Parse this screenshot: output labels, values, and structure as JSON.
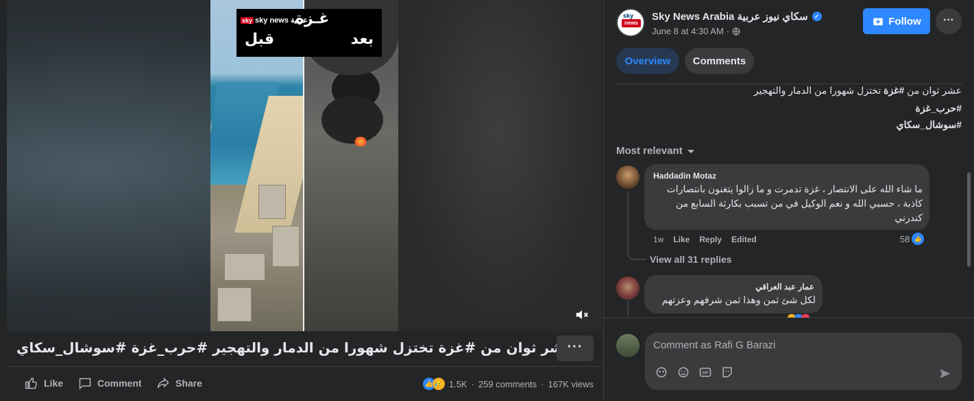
{
  "video": {
    "overlay_logo": "sky news عربية",
    "overlay_title": "غـزة",
    "overlay_before": "قبل",
    "overlay_after": "بعد",
    "title": "عشر ثوان من #غزة تختزل شهورا من الدمار والتهجير #حرب_غزة #سوشال_سكاي"
  },
  "actions": {
    "like": "Like",
    "comment": "Comment",
    "share": "Share",
    "reactions_count": "1.5K",
    "comments_count": "259 comments",
    "views": "167K views"
  },
  "post": {
    "page_name": "Sky News Arabia سكاي نيوز عربية",
    "date": "June 8 at 4:30 AM",
    "follow_label": "Follow",
    "tabs": [
      "Overview",
      "Comments"
    ],
    "caption_line1_pre": "عشر ثوان من ",
    "caption_line1_tag": "#غزة",
    "caption_line1_post": " تختزل شهورا من الدمار والتهجير",
    "caption_tag2": "#حرب_غزة",
    "caption_tag3": "#سوشال_سكاي"
  },
  "comments": {
    "sort_label": "Most relevant",
    "items": [
      {
        "author": "Haddadin Motaz",
        "text": "ما شاء الله على الانتصار ، غزة تدمرت و ما زالوا يتغنون بانتصارات كاذبة ، حسبي الله و نعم الوكيل في من تسبب بكارثة السابع من كندرني",
        "time": "1w",
        "like": "Like",
        "reply": "Reply",
        "edited": "Edited",
        "likes": "58",
        "view_replies": "View all 31 replies"
      },
      {
        "author": "عمار عبد العراقي",
        "text": "لكل شئ ثمن وهذا ثمن شرفهم وعزتهم"
      }
    ],
    "input_placeholder": "Comment as Rafi G Barazi"
  },
  "colors": {
    "accent": "#2d88ff",
    "background": "#18191a",
    "panel": "#242526",
    "bubble": "#3a3b3c"
  }
}
